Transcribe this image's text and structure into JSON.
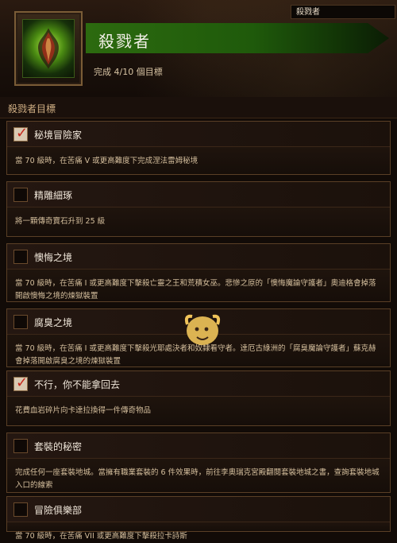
{
  "header": {
    "search_value": "殺戮者",
    "banner_title": "殺戮者",
    "progress_text": "完成 4/10 個目標",
    "icon_name": "achievement-flame-icon"
  },
  "section": {
    "title": "殺戮者目標"
  },
  "objectives": [
    {
      "title": "秘境冒險家",
      "completed": true,
      "description": "當 70 級時，在苦痛 V 或更高難度下完成涅法雷姆秘境"
    },
    {
      "title": "精雕細琢",
      "completed": false,
      "description": "將一顆傳奇寶石升到 25 級"
    },
    {
      "title": "懊悔之境",
      "completed": false,
      "description": "當 70 級時，在苦痛 I 或更高難度下擊殺亡靈之王和荒積女巫。悲慘之原的「懊悔魔論守護者」奧迪格會掉落開啟懊悔之境的煉獄裝置"
    },
    {
      "title": "腐臭之境",
      "completed": false,
      "description": "當 70 級時，在苦痛 I 或更高難度下擊殺光耶處決者和奴隸看守者。達厄古綠洲的「腐臭魔論守護者」蘇克赫會掉落開啟腐臭之境的煉獄裝置"
    },
    {
      "title": "不行，你不能拿回去",
      "completed": true,
      "description": "花費血岩碎片向卡達拉換得一件傳奇物品"
    },
    {
      "title": "套裝的秘密",
      "completed": false,
      "description": "完成任何一座套裝地城。當擁有職業套裝的 6 件效果時，前往李奧瑞克宮殿翻閱套裝地城之書，查詢套裝地城入口的線索"
    },
    {
      "title": "冒險俱樂部",
      "completed": false,
      "description": "當 70 級時，在苦痛 VII 或更高難度下擊殺拉卡詩斯"
    }
  ],
  "colors": {
    "banner_green": "#2c6a0f",
    "check_red": "#c6261b",
    "text_gold": "#d5bf9d"
  }
}
